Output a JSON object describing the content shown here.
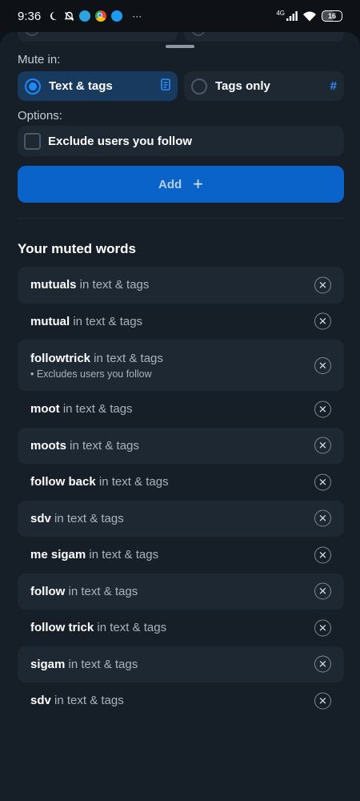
{
  "status_bar": {
    "time": "9:36",
    "overflow": "···",
    "network": "4G",
    "battery": "16"
  },
  "sheet": {
    "mute_in_label": "Mute in:",
    "mute_options": [
      {
        "label": "Text & tags",
        "selected": true,
        "icon": "document-icon",
        "glyph": "▯"
      },
      {
        "label": "Tags only",
        "selected": false,
        "icon": "hashtag-icon",
        "glyph": "#"
      }
    ],
    "options_label": "Options:",
    "exclude_label": "Exclude users you follow",
    "add_label": "Add",
    "add_glyph": "+",
    "muted_title": "Your muted words",
    "scope_text": " in text & tags",
    "words": [
      {
        "word": "mutuals",
        "note": ""
      },
      {
        "word": "mutual",
        "note": ""
      },
      {
        "word": "followtrick",
        "note": "• Excludes users you follow"
      },
      {
        "word": "moot",
        "note": ""
      },
      {
        "word": "moots",
        "note": ""
      },
      {
        "word": "follow back",
        "note": ""
      },
      {
        "word": "sdv",
        "note": ""
      },
      {
        "word": "me sigam",
        "note": ""
      },
      {
        "word": "follow",
        "note": ""
      },
      {
        "word": "follow trick",
        "note": ""
      },
      {
        "word": "sigam",
        "note": ""
      },
      {
        "word": "sdv",
        "note": ""
      }
    ],
    "remove_glyph": "✕"
  },
  "colors": {
    "accent": "#1e88ff",
    "button": "#0a63c9",
    "background": "#161e27",
    "card": "#1e2833"
  }
}
